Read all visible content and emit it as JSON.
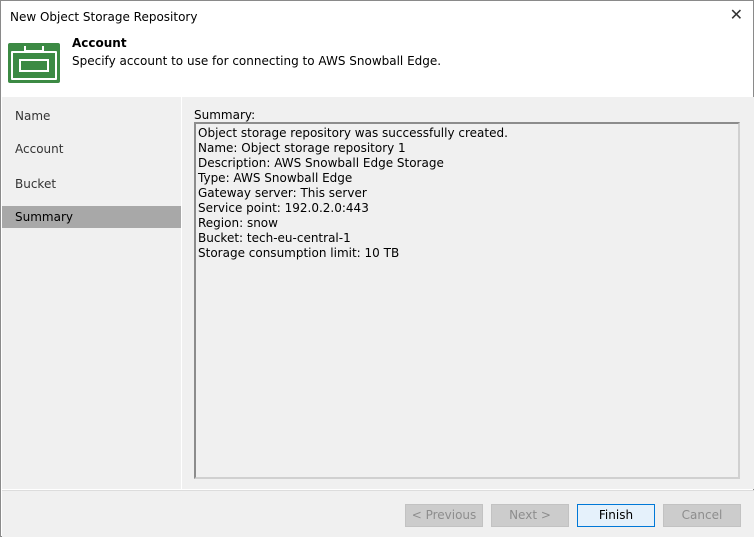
{
  "window": {
    "title": "New Object Storage Repository",
    "close": "✕"
  },
  "header": {
    "title": "Account",
    "description": "Specify account to use for connecting to AWS Snowball Edge."
  },
  "nav": [
    {
      "label": "Name"
    },
    {
      "label": "Account"
    },
    {
      "label": "Bucket"
    },
    {
      "label": "Summary",
      "active": true
    }
  ],
  "summary": {
    "label": "Summary:",
    "lines": [
      "Object storage repository was successfully created.",
      "Name: Object storage repository 1",
      "Description: AWS Snowball Edge Storage",
      "Type: AWS Snowball Edge",
      "Gateway server: This server",
      "Service point: 192.0.2.0:443",
      "Region: snow",
      "Bucket: tech-eu-central-1",
      "Storage consumption limit: 10 TB"
    ]
  },
  "buttons": {
    "previous": "< Previous",
    "next": "Next >",
    "finish": "Finish",
    "cancel": "Cancel"
  }
}
